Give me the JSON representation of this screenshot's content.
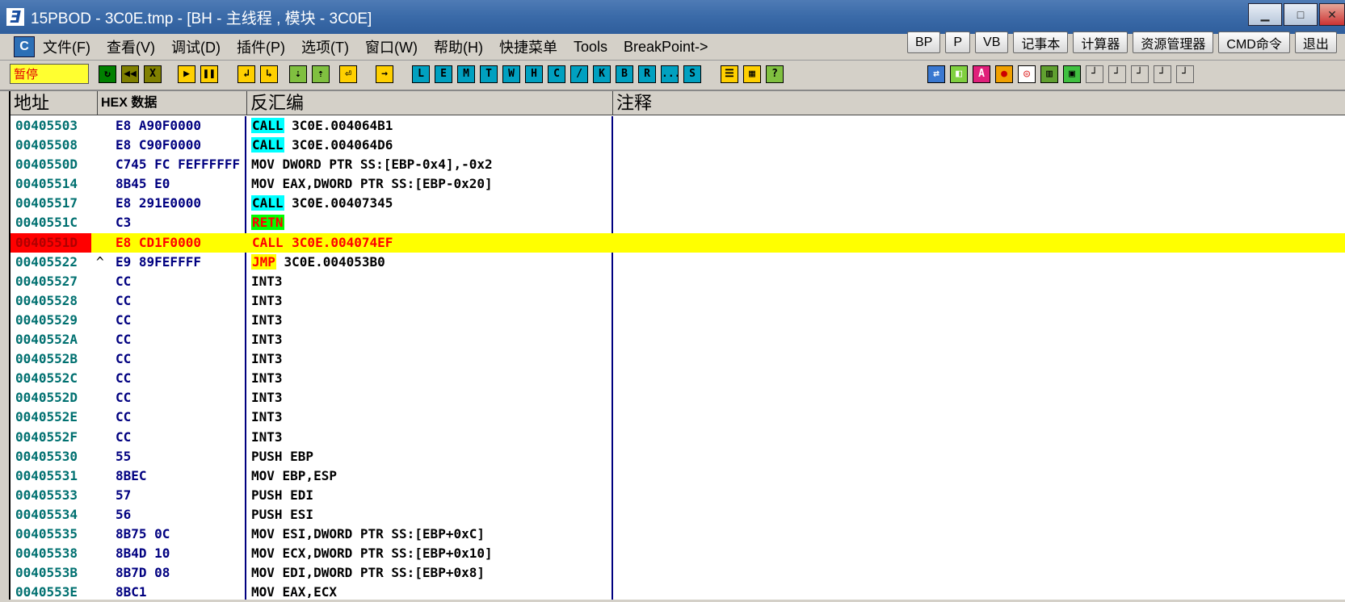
{
  "window": {
    "title": "15PBOD  - 3C0E.tmp - [BH - 主线程 , 模块 - 3C0E]",
    "icon": "ollydbg-icon",
    "buttons": [
      "minimize",
      "maximize",
      "close"
    ]
  },
  "menu": {
    "items": [
      "文件(F)",
      "查看(V)",
      "调试(D)",
      "插件(P)",
      "选项(T)",
      "窗口(W)",
      "帮助(H)",
      "快捷菜单",
      "Tools",
      "BreakPoint->"
    ]
  },
  "quick_buttons": [
    "BP",
    "P",
    "VB",
    "记事本",
    "计算器",
    "资源管理器",
    "CMD命令",
    "退出"
  ],
  "toolbar": {
    "status": "暂停",
    "debug_icons": [
      "restart-icon",
      "close-icon",
      "x-icon",
      "run-icon",
      "pause-icon",
      "step-into-icon",
      "step-over-icon",
      "trace-into-icon",
      "trace-over-icon",
      "execute-till-return-icon",
      "goto-icon"
    ],
    "window_letters": [
      "L",
      "E",
      "M",
      "T",
      "W",
      "H",
      "C",
      "/",
      "K",
      "B",
      "R",
      "...",
      "S"
    ],
    "extra_icons": [
      "list-icon",
      "grid-icon",
      "help-icon"
    ],
    "right_icons": [
      "refresh-icon",
      "plugin-icon",
      "a-icon",
      "red-circle-icon",
      "target-icon",
      "equalizer-icon",
      "screen-icon"
    ]
  },
  "columns": {
    "address": "地址",
    "hex": "HEX 数据",
    "disasm": "反汇编",
    "comment": "注释"
  },
  "colors": {
    "selected_row_bg": "#ffff00",
    "selected_addr_bg": "#ff0000",
    "call_highlight": "#00ffff",
    "retn_highlight": "#00ff00",
    "address_text": "#007070",
    "hex_text": "#000080"
  },
  "rows": [
    {
      "addr": "00405503",
      "mark": "",
      "hex": "E8 A90F0000",
      "kw": "CALL",
      "kw_type": "call",
      "rest": " 3C0E.004064B1"
    },
    {
      "addr": "00405508",
      "mark": "",
      "hex": "E8 C90F0000",
      "kw": "CALL",
      "kw_type": "call",
      "rest": " 3C0E.004064D6"
    },
    {
      "addr": "0040550D",
      "mark": "",
      "hex": "C745 FC FEFFFFFF",
      "kw": "",
      "kw_type": "",
      "rest": "MOV DWORD PTR SS:[EBP-0x4],-0x2"
    },
    {
      "addr": "00405514",
      "mark": "",
      "hex": "8B45 E0",
      "kw": "",
      "kw_type": "",
      "rest": "MOV EAX,DWORD PTR SS:[EBP-0x20]"
    },
    {
      "addr": "00405517",
      "mark": "",
      "hex": "E8 291E0000",
      "kw": "CALL",
      "kw_type": "call",
      "rest": " 3C0E.00407345"
    },
    {
      "addr": "0040551C",
      "mark": "",
      "hex": "C3",
      "kw": "RETN",
      "kw_type": "retn",
      "rest": ""
    },
    {
      "addr": "0040551D",
      "mark": "",
      "hex": "E8 CD1F0000",
      "kw": "CALL",
      "kw_type": "call",
      "rest": " 3C0E.004074EF",
      "selected": true
    },
    {
      "addr": "00405522",
      "mark": "^",
      "hex": "E9 89FEFFFF",
      "kw": "JMP",
      "kw_type": "jmp",
      "rest": " 3C0E.004053B0"
    },
    {
      "addr": "00405527",
      "mark": "",
      "hex": "CC",
      "kw": "",
      "kw_type": "",
      "rest": "INT3"
    },
    {
      "addr": "00405528",
      "mark": "",
      "hex": "CC",
      "kw": "",
      "kw_type": "",
      "rest": "INT3"
    },
    {
      "addr": "00405529",
      "mark": "",
      "hex": "CC",
      "kw": "",
      "kw_type": "",
      "rest": "INT3"
    },
    {
      "addr": "0040552A",
      "mark": "",
      "hex": "CC",
      "kw": "",
      "kw_type": "",
      "rest": "INT3"
    },
    {
      "addr": "0040552B",
      "mark": "",
      "hex": "CC",
      "kw": "",
      "kw_type": "",
      "rest": "INT3"
    },
    {
      "addr": "0040552C",
      "mark": "",
      "hex": "CC",
      "kw": "",
      "kw_type": "",
      "rest": "INT3"
    },
    {
      "addr": "0040552D",
      "mark": "",
      "hex": "CC",
      "kw": "",
      "kw_type": "",
      "rest": "INT3"
    },
    {
      "addr": "0040552E",
      "mark": "",
      "hex": "CC",
      "kw": "",
      "kw_type": "",
      "rest": "INT3"
    },
    {
      "addr": "0040552F",
      "mark": "",
      "hex": "CC",
      "kw": "",
      "kw_type": "",
      "rest": "INT3"
    },
    {
      "addr": "00405530",
      "mark": "",
      "hex": "55",
      "kw": "",
      "kw_type": "",
      "rest": "PUSH EBP"
    },
    {
      "addr": "00405531",
      "mark": "",
      "hex": "8BEC",
      "kw": "",
      "kw_type": "",
      "rest": "MOV EBP,ESP"
    },
    {
      "addr": "00405533",
      "mark": "",
      "hex": "57",
      "kw": "",
      "kw_type": "",
      "rest": "PUSH EDI"
    },
    {
      "addr": "00405534",
      "mark": "",
      "hex": "56",
      "kw": "",
      "kw_type": "",
      "rest": "PUSH ESI"
    },
    {
      "addr": "00405535",
      "mark": "",
      "hex": "8B75 0C",
      "kw": "",
      "kw_type": "",
      "rest": "MOV ESI,DWORD PTR SS:[EBP+0xC]"
    },
    {
      "addr": "00405538",
      "mark": "",
      "hex": "8B4D 10",
      "kw": "",
      "kw_type": "",
      "rest": "MOV ECX,DWORD PTR SS:[EBP+0x10]"
    },
    {
      "addr": "0040553B",
      "mark": "",
      "hex": "8B7D 08",
      "kw": "",
      "kw_type": "",
      "rest": "MOV EDI,DWORD PTR SS:[EBP+0x8]"
    },
    {
      "addr": "0040553E",
      "mark": "",
      "hex": "8BC1",
      "kw": "",
      "kw_type": "",
      "rest": "MOV EAX,ECX"
    }
  ]
}
